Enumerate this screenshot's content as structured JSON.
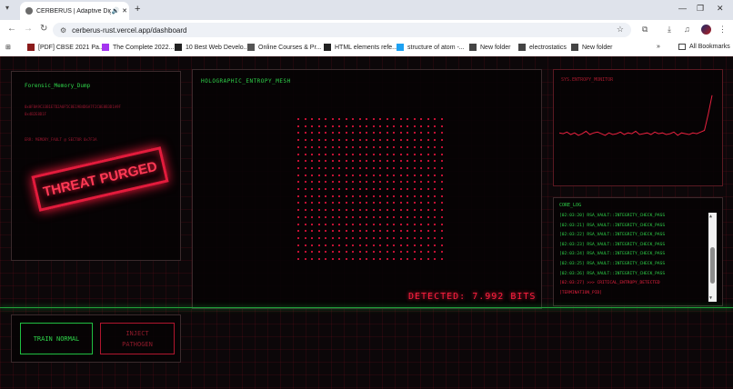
{
  "browser": {
    "tab_title": "CERBERUS | Adaptive Digit",
    "new_tab_symbol": "+",
    "url": "cerberus-rust.vercel.app/dashboard",
    "bookmarks": [
      {
        "label": "[PDF] CBSE 2021 Pa...",
        "color": "#8a1b1b"
      },
      {
        "label": "The Complete 2022...",
        "color": "#a435f0"
      },
      {
        "label": "10 Best Web Develo...",
        "color": "#222222"
      },
      {
        "label": "Online Courses & Pr...",
        "color": "#555555"
      },
      {
        "label": "HTML elements refe...",
        "color": "#222222"
      },
      {
        "label": "structure of atom -...",
        "color": "#1da1f2"
      },
      {
        "label": "New folder",
        "color": "#444444"
      },
      {
        "label": "electrostatics",
        "color": "#444444"
      },
      {
        "label": "New folder",
        "color": "#444444"
      }
    ],
    "all_bookmarks": "All Bookmarks"
  },
  "forensic": {
    "title": "Forensic_Memory_Dump",
    "hex_lines": [
      "0x0F8A9C33B1E7D2A0F5C8E19B4D6A7F2C0E8B3D1A9F",
      "0x4B2E8D1F",
      "ERR: MEMORY_FAULT @ SECTOR 0x7F3A"
    ],
    "stamp": "THREAT PURGED"
  },
  "holo": {
    "title": "HOLOGRAPHIC_ENTROPY_MESH",
    "detected": "DETECTED: 7.992 BITS"
  },
  "entropy": {
    "title": "SYS.ENTROPY_MONITOR",
    "series": [
      0.32,
      0.31,
      0.33,
      0.3,
      0.32,
      0.29,
      0.31,
      0.34,
      0.3,
      0.32,
      0.33,
      0.31,
      0.29,
      0.32,
      0.3,
      0.31,
      0.33,
      0.3,
      0.32,
      0.31,
      0.34,
      0.3,
      0.31,
      0.32,
      0.3,
      0.33,
      0.31,
      0.32,
      0.3,
      0.31,
      0.33,
      0.29,
      0.32,
      0.31,
      0.3,
      0.32,
      0.31,
      0.33,
      0.35,
      0.55,
      0.78
    ]
  },
  "core_log": {
    "title": "CORE_LOG",
    "lines": [
      {
        "text": "[02:03:20] RSA_VAULT::INTEGRITY_CHECK_PASS",
        "color": "#2fd34a"
      },
      {
        "text": "[02:03:21] RSA_VAULT::INTEGRITY_CHECK_PASS",
        "color": "#2fd34a"
      },
      {
        "text": "[02:03:22] RSA_VAULT::INTEGRITY_CHECK_PASS",
        "color": "#2fd34a"
      },
      {
        "text": "[02:03:23] RSA_VAULT::INTEGRITY_CHECK_PASS",
        "color": "#2fd34a"
      },
      {
        "text": "[02:03:24] RSA_VAULT::INTEGRITY_CHECK_PASS",
        "color": "#2fd34a"
      },
      {
        "text": "[02:03:25] RSA_VAULT::INTEGRITY_CHECK_PASS",
        "color": "#2fd34a"
      },
      {
        "text": "[02:03:26] RSA_VAULT::INTEGRITY_CHECK_PASS",
        "color": "#2fd34a"
      },
      {
        "text": "[02:03:27] >>> CRITICAL_ENTROPY_DETECTED",
        "color": "#e8213f"
      },
      {
        "text": "[TERMINATION_PID]",
        "color": "#e8213f"
      }
    ]
  },
  "controls": {
    "train_label": "TRAIN NORMAL",
    "inject_line1": "INJECT",
    "inject_line2": "PATHOGEN"
  },
  "colors": {
    "accent_red": "#ff1744",
    "accent_green": "#2fd34a"
  }
}
